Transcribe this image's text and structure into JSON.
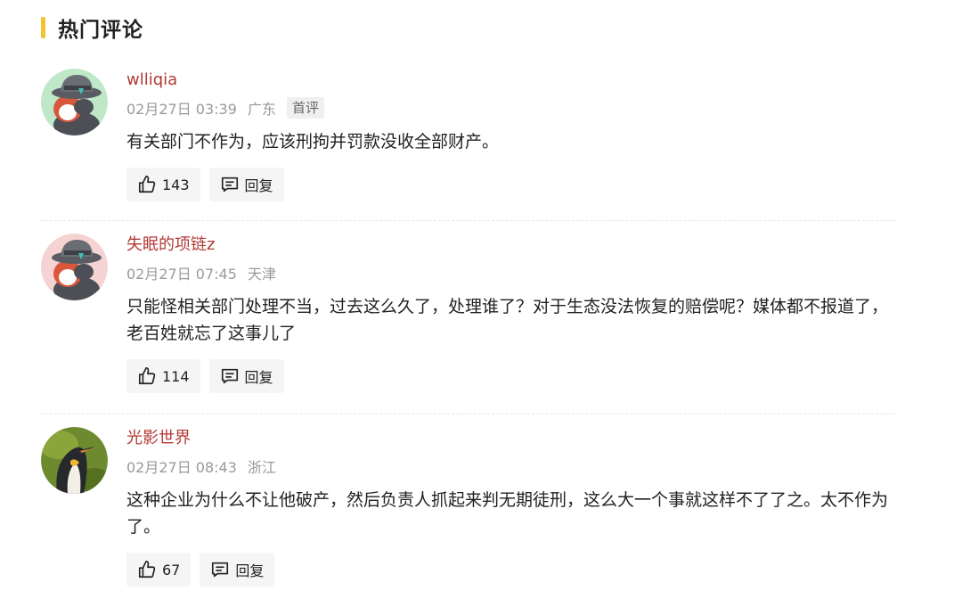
{
  "section": {
    "title": "热门评论"
  },
  "colors": {
    "accent": "#f2c230",
    "username": "#b23a36",
    "meta": "#9a9a9a"
  },
  "comments": [
    {
      "username": "wlliqia",
      "date": "02月27日 03:39",
      "location": "广东",
      "badge": "首评",
      "text": "有关部门不作为，应该刑拘并罚款没收全部财产。",
      "likes": "143",
      "reply_label": "回复",
      "avatar_icon": "cartoon-animal-avatar-icon"
    },
    {
      "username": "失眠的项链z",
      "date": "02月27日 07:45",
      "location": "天津",
      "text": "只能怪相关部门处理不当，过去这么久了，处理谁了？对于生态没法恢复的赔偿呢？媒体都不报道了，老百姓就忘了这事儿了",
      "likes": "114",
      "reply_label": "回复",
      "avatar_icon": "cartoon-animal-avatar-icon"
    },
    {
      "username": "光影世界",
      "date": "02月27日 08:43",
      "location": "浙江",
      "text": "这种企业为什么不让他破产，然后负责人抓起来判无期徒刑，这么大一个事就这样不了了之。太不作为了。",
      "likes": "67",
      "reply_label": "回复",
      "avatar_icon": "penguin-photo-avatar-icon"
    }
  ]
}
